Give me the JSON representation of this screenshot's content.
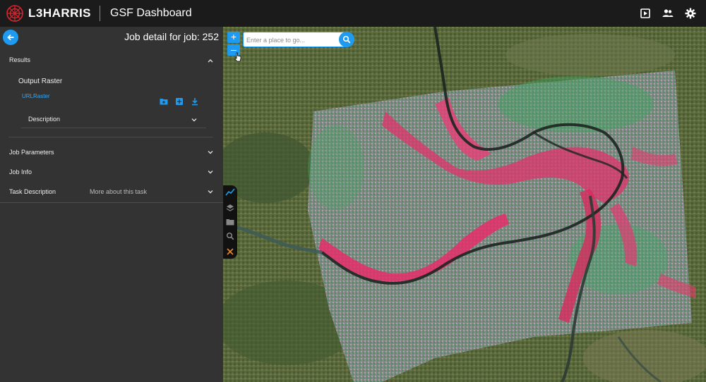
{
  "header": {
    "brand": "L3HARRIS",
    "title": "GSF Dashboard",
    "icons": [
      "play-box-icon",
      "users-icon",
      "gear-icon"
    ],
    "colors": {
      "bg": "#1b1b1b",
      "logo_red": "#d7262f"
    }
  },
  "panel": {
    "title": "Job detail for job: 252",
    "back_icon": "arrow-left-icon",
    "results": {
      "label": "Results",
      "output_title": "Output Raster",
      "link": "URLRaster",
      "actions": [
        "folder-add-icon",
        "add-box-icon",
        "download-icon"
      ],
      "description_label": "Description"
    },
    "rows": [
      {
        "label": "Job Parameters"
      },
      {
        "label": "Job Info"
      },
      {
        "label": "Task Description",
        "extra": "More about this task"
      }
    ]
  },
  "map": {
    "zoom_in": "+",
    "zoom_out": "–",
    "search_placeholder": "Enter a place to go...",
    "search_icon": "search-icon",
    "tools": [
      "chart-line-icon",
      "layers-icon",
      "folder-icon",
      "magnify-icon",
      "close-icon"
    ],
    "accent": "#1e9bf0"
  }
}
